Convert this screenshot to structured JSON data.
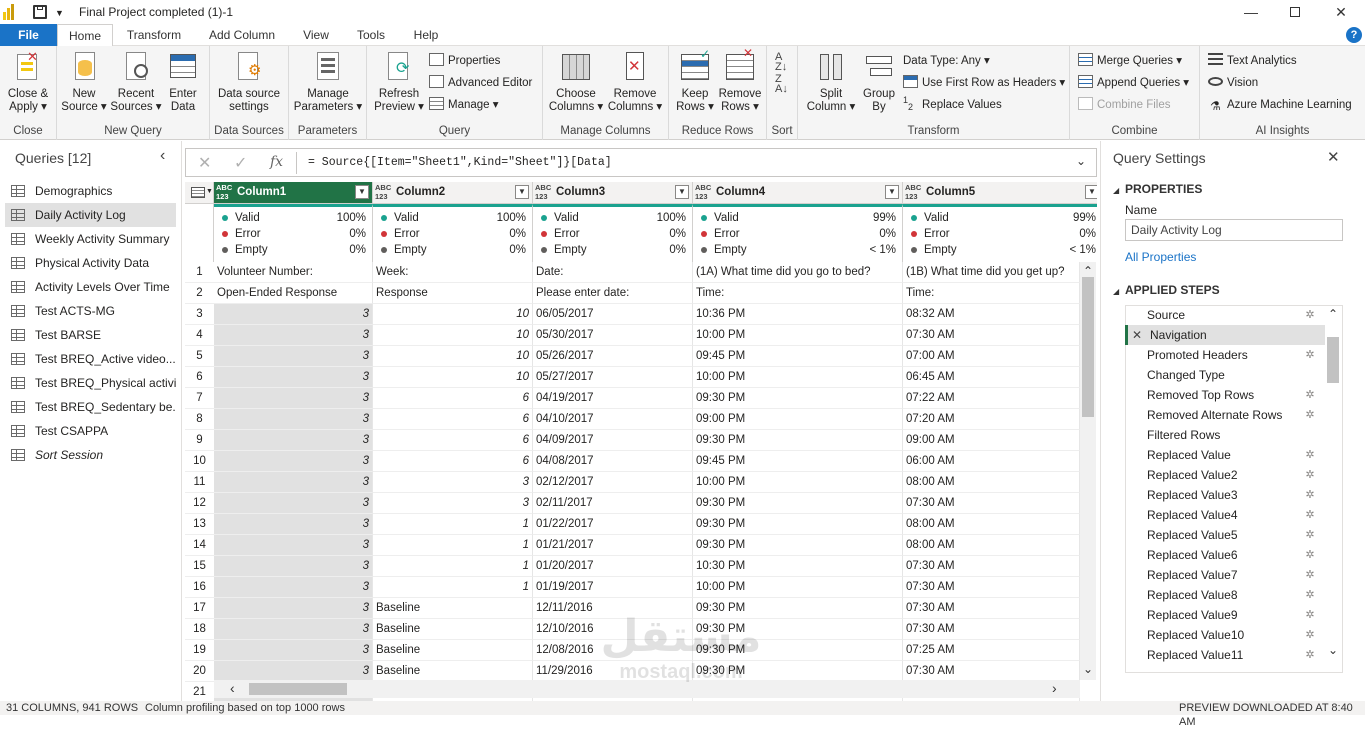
{
  "window": {
    "title": "Final Project completed (1)-1"
  },
  "menu": {
    "tabs": [
      "File",
      "Home",
      "Transform",
      "Add Column",
      "View",
      "Tools",
      "Help"
    ]
  },
  "ribbon": {
    "close": {
      "label1": "Close &",
      "label2": "Apply ▾",
      "group": "Close"
    },
    "new_query": {
      "new1": "New",
      "new2": "Source ▾",
      "recent1": "Recent",
      "recent2": "Sources ▾",
      "enter1": "Enter",
      "enter2": "Data",
      "group": "New Query"
    },
    "data_sources": {
      "l1": "Data source",
      "l2": "settings",
      "group": "Data Sources"
    },
    "parameters": {
      "l1": "Manage",
      "l2": "Parameters ▾",
      "group": "Parameters"
    },
    "query": {
      "refresh1": "Refresh",
      "refresh2": "Preview ▾",
      "properties": "Properties",
      "advanced": "Advanced Editor",
      "manage": "Manage ▾",
      "group": "Query"
    },
    "manage_columns": {
      "choose1": "Choose",
      "choose2": "Columns ▾",
      "remove1": "Remove",
      "remove2": "Columns ▾",
      "group": "Manage Columns"
    },
    "reduce_rows": {
      "keep1": "Keep",
      "keep2": "Rows ▾",
      "remove1": "Remove",
      "remove2": "Rows ▾",
      "group": "Reduce Rows"
    },
    "sort": {
      "group": "Sort"
    },
    "transform": {
      "split1": "Split",
      "split2": "Column ▾",
      "group1": "Group",
      "group2": "By",
      "datatype": "Data Type: Any ▾",
      "firstrow": "Use First Row as Headers ▾",
      "replace": "Replace Values",
      "group": "Transform"
    },
    "combine": {
      "merge": "Merge Queries ▾",
      "append": "Append Queries ▾",
      "files": "Combine Files",
      "group": "Combine"
    },
    "ai": {
      "text": "Text Analytics",
      "vision": "Vision",
      "azure": "Azure Machine Learning",
      "group": "AI Insights"
    }
  },
  "queries": {
    "header": "Queries [12]",
    "items": [
      "Demographics",
      "Daily Activity Log",
      "Weekly Activity Summary",
      "Physical Activity Data",
      "Activity Levels Over Time",
      "Test ACTS-MG",
      "Test BARSE",
      "Test BREQ_Active video...",
      "Test BREQ_Physical activi...",
      "Test BREQ_Sedentary be...",
      "Test CSAPPA",
      "Sort Session"
    ],
    "selected_index": 1
  },
  "formula": {
    "text": "= Source{[Item=\"Sheet1\",Kind=\"Sheet\"]}[Data]",
    "fx": "fx"
  },
  "grid": {
    "type_badge_top": "ABC",
    "type_badge_bottom": "123",
    "columns": [
      "Column1",
      "Column2",
      "Column3",
      "Column4",
      "Column5"
    ],
    "profile": [
      {
        "valid": "100%",
        "error": "0%",
        "empty": "0%"
      },
      {
        "valid": "100%",
        "error": "0%",
        "empty": "0%"
      },
      {
        "valid": "100%",
        "error": "0%",
        "empty": "0%"
      },
      {
        "valid": "99%",
        "error": "0%",
        "empty": "< 1%"
      },
      {
        "valid": "99%",
        "error": "0%",
        "empty": "< 1%"
      }
    ],
    "profile_labels": {
      "valid": "Valid",
      "error": "Error",
      "empty": "Empty"
    },
    "rows": [
      [
        "1",
        "Volunteer Number:",
        "Week:",
        "Date:",
        "(1A)   What time did you go to bed?",
        "(1B)   What time did you get up?"
      ],
      [
        "2",
        "Open-Ended Response",
        "Response",
        "Please enter date:",
        "Time:",
        "Time:"
      ],
      [
        "3",
        "3",
        "10",
        "06/05/2017",
        "10:36 PM",
        "08:32 AM"
      ],
      [
        "4",
        "3",
        "10",
        "05/30/2017",
        "10:00 PM",
        "07:30 AM"
      ],
      [
        "5",
        "3",
        "10",
        "05/26/2017",
        "09:45 PM",
        "07:00 AM"
      ],
      [
        "6",
        "3",
        "10",
        "05/27/2017",
        "10:00 PM",
        "06:45 AM"
      ],
      [
        "7",
        "3",
        "6",
        "04/19/2017",
        "09:30 PM",
        "07:22 AM"
      ],
      [
        "8",
        "3",
        "6",
        "04/10/2017",
        "09:00 PM",
        "07:20 AM"
      ],
      [
        "9",
        "3",
        "6",
        "04/09/2017",
        "09:30 PM",
        "09:00 AM"
      ],
      [
        "10",
        "3",
        "6",
        "04/08/2017",
        "09:45 PM",
        "06:00 AM"
      ],
      [
        "11",
        "3",
        "3",
        "02/12/2017",
        "10:00 PM",
        "08:00 AM"
      ],
      [
        "12",
        "3",
        "3",
        "02/11/2017",
        "09:30 PM",
        "07:30 AM"
      ],
      [
        "13",
        "3",
        "1",
        "01/22/2017",
        "09:30 PM",
        "08:00 AM"
      ],
      [
        "14",
        "3",
        "1",
        "01/21/2017",
        "09:30 PM",
        "08:00 AM"
      ],
      [
        "15",
        "3",
        "1",
        "01/20/2017",
        "10:30 PM",
        "07:30 AM"
      ],
      [
        "16",
        "3",
        "1",
        "01/19/2017",
        "10:00 PM",
        "07:30 AM"
      ],
      [
        "17",
        "3",
        "Baseline",
        "12/11/2016",
        "09:30 PM",
        "07:30 AM"
      ],
      [
        "18",
        "3",
        "Baseline",
        "12/10/2016",
        "09:30 PM",
        "07:30 AM"
      ],
      [
        "19",
        "3",
        "Baseline",
        "12/08/2016",
        "09:30 PM",
        "07:25 AM"
      ],
      [
        "20",
        "3",
        "Baseline",
        "11/29/2016",
        "09:30 PM",
        "07:30 AM"
      ],
      [
        "21",
        "",
        "",
        "",
        "",
        ""
      ]
    ]
  },
  "settings": {
    "title": "Query Settings",
    "properties_header": "PROPERTIES",
    "name_label": "Name",
    "name_value": "Daily Activity Log",
    "all_properties": "All Properties",
    "steps_header": "APPLIED STEPS",
    "steps": [
      "Source",
      "Navigation",
      "Promoted Headers",
      "Changed Type",
      "Removed Top Rows",
      "Removed Alternate Rows",
      "Filtered Rows",
      "Replaced Value",
      "Replaced Value2",
      "Replaced Value3",
      "Replaced Value4",
      "Replaced Value5",
      "Replaced Value6",
      "Replaced Value7",
      "Replaced Value8",
      "Replaced Value9",
      "Replaced Value10",
      "Replaced Value11"
    ],
    "steps_with_gear": [
      0,
      2,
      4,
      5,
      7,
      8,
      9,
      10,
      11,
      12,
      13,
      14,
      15,
      16,
      17
    ]
  },
  "status": {
    "left": "31 COLUMNS, 941 ROWS",
    "mid": "Column profiling based on top 1000 rows",
    "right": "PREVIEW DOWNLOADED AT 8:40 AM"
  },
  "watermark": {
    "arabic": "مستقل",
    "latin": "mostaql.com"
  },
  "colors": {
    "accent": "#1a73c7",
    "valid": "#1aa28f",
    "error": "#d13438",
    "empty": "#605e5c",
    "selected_col": "#217346"
  }
}
